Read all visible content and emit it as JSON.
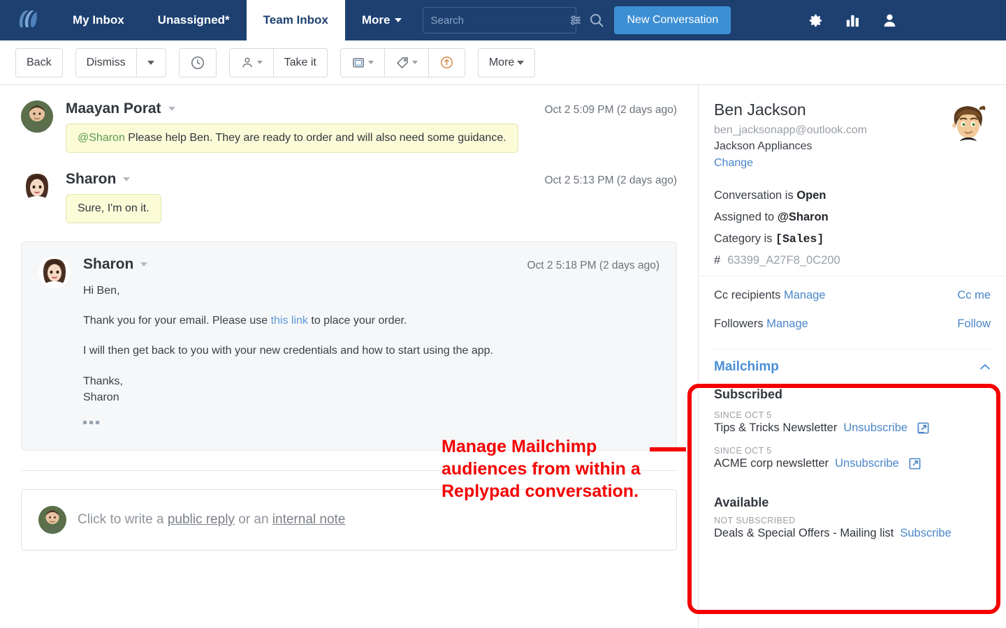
{
  "navbar": {
    "logo_icon": "replypad-logo-icon",
    "tabs": [
      {
        "label": "My Inbox",
        "active": false,
        "has_caret": false
      },
      {
        "label": "Unassigned*",
        "active": false,
        "has_caret": false
      },
      {
        "label": "Team Inbox",
        "active": true,
        "has_caret": false
      },
      {
        "label": "More",
        "active": false,
        "has_caret": true
      }
    ],
    "search": {
      "value": "",
      "placeholder": "Search",
      "filter_icon": "sliders-icon",
      "go_icon": "search-icon"
    },
    "new_conversation_label": "New Conversation",
    "icons": [
      {
        "name": "gear-icon"
      },
      {
        "name": "reports-bar-chart-icon"
      },
      {
        "name": "user-account-icon"
      }
    ]
  },
  "toolbar": {
    "back_label": "Back",
    "dismiss_label": "Dismiss",
    "dismiss_caret_icon": "chevron-down-icon",
    "snooze_icon": "clock-icon",
    "assign_icon": "person-icon",
    "assign_caret_icon": "chevron-down-icon",
    "take_it_label": "Take it",
    "folder_icon": "folder-icon",
    "folder_caret_icon": "chevron-down-icon",
    "tag_icon": "tag-icon",
    "tag_caret_icon": "chevron-down-icon",
    "upload_icon": "arrow-up-circle-icon",
    "more_label": "More",
    "more_caret_icon": "chevron-down-icon"
  },
  "thread": {
    "messages": [
      {
        "author": "Maayan Porat",
        "timestamp": "Oct 2 5:09 PM (2 days ago)",
        "type": "note",
        "mention": "@Sharon",
        "text": " Please help Ben. They are ready to order and will also need some guidance."
      },
      {
        "author": "Sharon",
        "timestamp": "Oct 2 5:13 PM (2 days ago)",
        "type": "note",
        "mention": "",
        "text": "Sure, I'm on  it."
      }
    ],
    "email": {
      "author": "Sharon",
      "timestamp": "Oct 2 5:18 PM (2 days ago)",
      "line1": "Hi Ben,",
      "line2_pre": "Thank you for your email. Please use ",
      "line2_link": "this link",
      "line2_post": " to place your order.",
      "line3": "I will then get back to you with your new credentials and how to start using the app.",
      "line4": "Thanks,",
      "line5": "Sharon",
      "expand_icon": "ellipsis-expand-icon"
    }
  },
  "composer": {
    "prefix": "Click to write a ",
    "public_reply_label": "public reply",
    "middle": " or an ",
    "internal_note_label": "internal note",
    "avatar_icon": "user-avatar"
  },
  "sidebar": {
    "contact": {
      "name": "Ben Jackson",
      "email": "ben_jacksonapp@outlook.com",
      "company": "Jackson Appliances",
      "change_label": "Change",
      "avatar_icon": "contact-avatar"
    },
    "meta": {
      "conversation_prefix": "Conversation is ",
      "conversation_status": "Open",
      "assigned_prefix": "Assigned to ",
      "assigned_to": "@Sharon",
      "category_prefix": "Category is ",
      "category_value": "[Sales]",
      "id_hash": "#",
      "id_value": "63399_A27F8_0C200"
    },
    "cc": {
      "label": "Cc recipients",
      "manage_label": "Manage",
      "action_label": "Cc me"
    },
    "followers": {
      "label": "Followers",
      "manage_label": "Manage",
      "action_label": "Follow"
    },
    "mailchimp": {
      "title": "Mailchimp",
      "collapse_icon": "chevron-up-icon",
      "subscribed_title": "Subscribed",
      "subscribed_items": [
        {
          "since": "SINCE OCT 5",
          "name": "Tips & Tricks Newsletter",
          "action": "Unsubscribe",
          "external_icon": "external-link-icon"
        },
        {
          "since": "SINCE OCT 5",
          "name": "ACME corp newsletter",
          "action": "Unsubscribe",
          "external_icon": "external-link-icon"
        }
      ],
      "available_title": "Available",
      "available_items": [
        {
          "since": "NOT SUBSCRIBED",
          "name": "Deals & Special Offers - Mailing list",
          "action": "Subscribe"
        }
      ]
    }
  },
  "annotation": {
    "text": "Manage Mailchimp audiences from within a Replypad conversation.",
    "color": "#f40000"
  },
  "colors": {
    "navbar_bg": "#1d4071",
    "primary_button": "#3d8fd4",
    "link": "#4a86c9",
    "mention_green": "#5b9a4e",
    "note_bubble": "#fbfbd8",
    "annotation_red": "#f40000"
  }
}
